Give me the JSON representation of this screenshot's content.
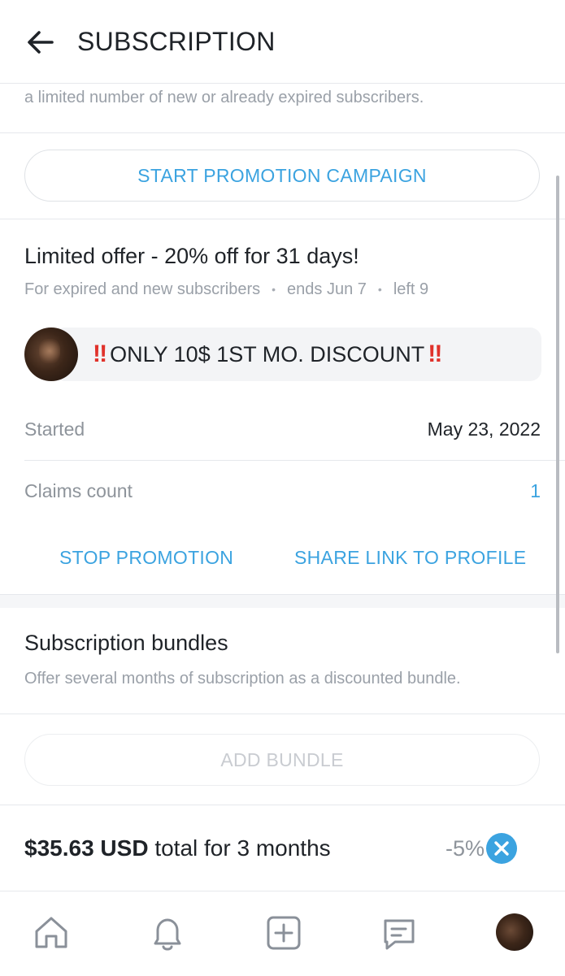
{
  "header": {
    "title": "SUBSCRIPTION",
    "back_icon": "arrow-left-icon"
  },
  "intro": {
    "text": "a limited number of new or already expired subscribers."
  },
  "promotion_button": {
    "label": "START PROMOTION CAMPAIGN"
  },
  "active_promotion": {
    "title": "Limited offer - 20% off for 31 days!",
    "audience": "For expired and new subscribers",
    "ends": "ends Jun 7",
    "left": "left 9",
    "message": "ONLY 10$ 1ST MO. DISCOUNT",
    "message_emoji": "‼",
    "started_label": "Started",
    "started_value": "May 23, 2022",
    "claims_label": "Claims count",
    "claims_value": "1",
    "stop_label": "STOP PROMOTION",
    "share_label": "SHARE LINK TO PROFILE"
  },
  "bundles": {
    "title": "Subscription bundles",
    "description": "Offer several months of subscription as a discounted bundle.",
    "add_label": "ADD BUNDLE",
    "items": [
      {
        "price": "$35.63 USD",
        "period": "total for 3 months",
        "discount": "-5%"
      }
    ]
  },
  "tabbar": {
    "items": [
      "home-icon",
      "bell-icon",
      "plus-square-icon",
      "message-icon",
      "profile-avatar"
    ]
  },
  "colors": {
    "accent": "#3ba3e0",
    "muted_text": "#9aa0a8",
    "divider": "#e6e8ec",
    "emoji_red": "#e0322b"
  }
}
